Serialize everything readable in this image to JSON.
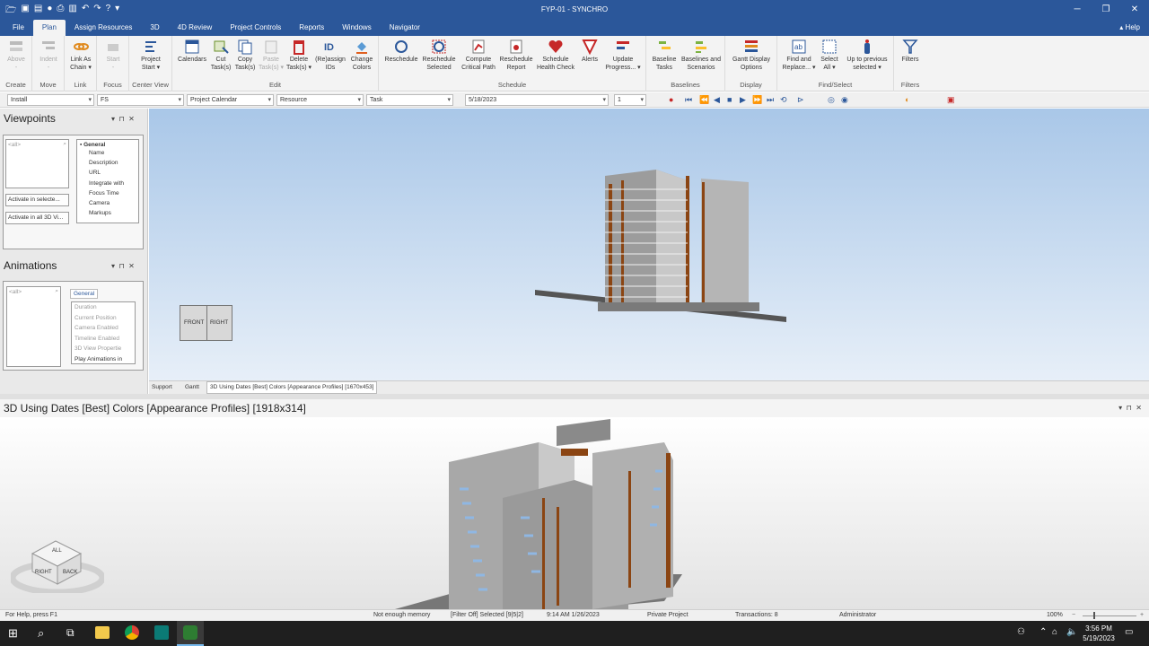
{
  "window": {
    "title": "FYP-01 - SYNCHRO"
  },
  "menu": {
    "tabs": [
      "File",
      "Plan",
      "Assign Resources",
      "3D",
      "4D Review",
      "Project Controls",
      "Reports",
      "Windows",
      "Navigator"
    ],
    "help": "Help"
  },
  "ribbon": {
    "groups": {
      "create": "Create",
      "move": "Move",
      "link": "Link",
      "focus": "Focus",
      "center_view": "Center View",
      "edit": "Edit",
      "schedule": "Schedule",
      "baselines": "Baselines",
      "display": "Display",
      "find_select": "Find/Select",
      "filters": "Filters"
    },
    "buttons": {
      "above": [
        "Above",
        "-"
      ],
      "indent": [
        "Indent",
        "-"
      ],
      "link_chain": [
        "Link As",
        "Chain ▾"
      ],
      "start": [
        "Start",
        "-"
      ],
      "project_start": [
        "Project",
        "Start ▾"
      ],
      "calendars": [
        "Calendars",
        ""
      ],
      "cut": [
        "Cut",
        "Task(s)"
      ],
      "copy": [
        "Copy",
        "Task(s)"
      ],
      "paste": [
        "Paste",
        "Task(s) ▾"
      ],
      "delete": [
        "Delete",
        "Task(s) ▾"
      ],
      "reassign": [
        "(Re)assign",
        "IDs"
      ],
      "change_colors": [
        "Change",
        "Colors"
      ],
      "reschedule": [
        "Reschedule",
        ""
      ],
      "reschedule_selected": [
        "Reschedule",
        "Selected"
      ],
      "compute_cp": [
        "Compute",
        "Critical Path"
      ],
      "reschedule_report": [
        "Reschedule",
        "Report"
      ],
      "health_check": [
        "Schedule",
        "Health Check"
      ],
      "alerts": [
        "Alerts",
        ""
      ],
      "update_progress": [
        "Update",
        "Progress... ▾"
      ],
      "baseline_tasks": [
        "Baseline",
        "Tasks"
      ],
      "baselines_scenarios": [
        "Baselines and",
        "Scenarios"
      ],
      "gantt_display": [
        "Gantt Display",
        "Options"
      ],
      "find_replace": [
        "Find and",
        "Replace... ▾"
      ],
      "select_all": [
        "Select",
        "All ▾"
      ],
      "up_previous": [
        "Up to previous",
        "selected ▾"
      ],
      "filters": [
        "Filters",
        ""
      ]
    }
  },
  "toolbar": {
    "combo_install": "Install",
    "combo_fs": "FS",
    "combo_calendar": "Project Calendar",
    "combo_resource": "Resource",
    "combo_task": "Task",
    "date": "5/18/2023",
    "step": "1"
  },
  "viewpoints": {
    "title": "Viewpoints",
    "search": "<all>",
    "btn_activate_selected": "Activate in selecte...",
    "btn_activate_all": "Activate in all 3D Vi...",
    "props_header": "General",
    "props": [
      "Name",
      "Description",
      "URL",
      "Integrate with",
      "Focus Time",
      "Camera",
      "Markups"
    ]
  },
  "animations": {
    "title": "Animations",
    "search": "<all>",
    "tab": "General",
    "props": [
      "Duration",
      "Current Position",
      "Camera Enabled",
      "Timeline Enabled",
      "3D View Propertie",
      "Play Animations in"
    ]
  },
  "view1": {
    "front": "FRONT",
    "right": "RIGHT"
  },
  "doc_tabs": [
    "Support",
    "Gantt",
    "3D Using Dates [Best] Colors [Appearance Profiles] [1670x453]"
  ],
  "view2": {
    "title": "3D Using Dates [Best] Colors [Appearance Profiles]  [1918x314]",
    "cube": [
      "ALL",
      "RIGHT",
      "BACK"
    ]
  },
  "status": {
    "help": "For Help, press F1",
    "memory": "Not enough memory",
    "filter": "[Filter Off]  Selected [9|5|2]",
    "datetime": "9:14 AM 1/26/2023",
    "project": "Private Project",
    "transactions": "Transactions: 8",
    "user": "Administrator",
    "zoom": "100%"
  },
  "taskbar": {
    "time": "3:56 PM",
    "date": "5/19/2023"
  },
  "colors": {
    "accent": "#2b579a",
    "sky_top": "#a9c7e8",
    "brick": "#8b4513"
  }
}
